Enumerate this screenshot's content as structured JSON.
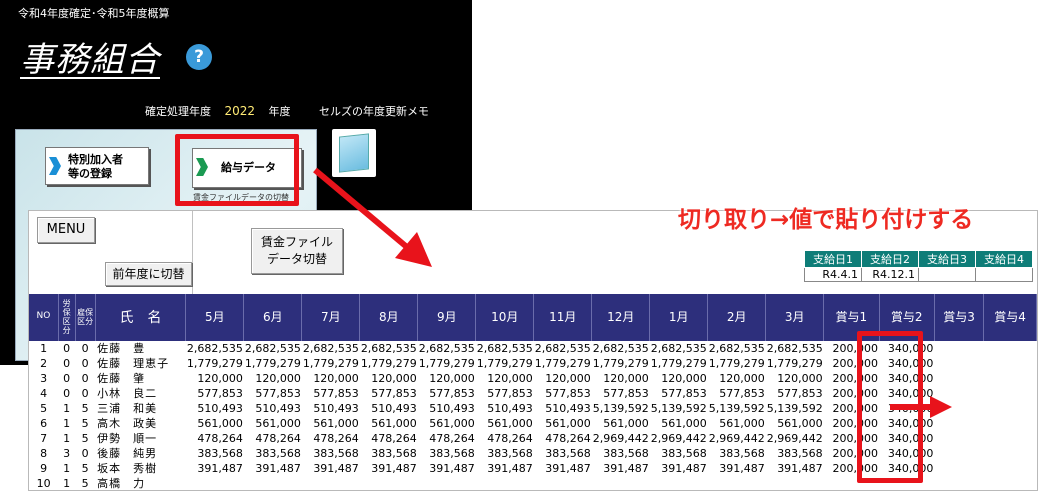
{
  "app": {
    "subtitle": "令和4年度確定･令和5年度概算",
    "title": "事務組合",
    "help_symbol": "?",
    "year_label": "確定処理年度",
    "year_value": "2022",
    "year_unit": "年度",
    "memo_label": "セルズの年度更新メモ",
    "btn_special_line1": "特別加入者",
    "btn_special_line2": "等の登録",
    "btn_salary": "給与データ",
    "salary_caption": "賃金ファイルデータの切替"
  },
  "annotation": {
    "headline": "切り取り→値で貼り付けする",
    "accent_color": "#e8131b"
  },
  "sheet": {
    "menu_label": "MENU",
    "prev_year_label": "前年度に切替",
    "wage_switch_line1": "賃金ファイル",
    "wage_switch_line2": "データ切替",
    "pay_days": {
      "headers": [
        "支給日1",
        "支給日2",
        "支給日3",
        "支給日4"
      ],
      "values": [
        "R4.4.1",
        "R4.12.1",
        "",
        ""
      ]
    },
    "columns": {
      "no": "NO",
      "rousai": "労保区分",
      "koyou": "雇保区分",
      "name": "氏　名",
      "months": [
        "5月",
        "6月",
        "7月",
        "8月",
        "9月",
        "10月",
        "11月",
        "12月",
        "1月",
        "2月",
        "3月"
      ],
      "bonus": [
        "賞与1",
        "賞与2",
        "賞与3",
        "賞与4"
      ]
    },
    "rows": [
      {
        "no": "1",
        "r": "0",
        "k": "0",
        "name": "佐藤　豊",
        "m": [
          "2,682,535",
          "2,682,535",
          "2,682,535",
          "2,682,535",
          "2,682,535",
          "2,682,535",
          "2,682,535",
          "2,682,535",
          "2,682,535",
          "2,682,535",
          "2,682,535"
        ],
        "b1": "200,000",
        "b2": "340,000"
      },
      {
        "no": "2",
        "r": "0",
        "k": "0",
        "name": "佐藤　理恵子",
        "m": [
          "1,779,279",
          "1,779,279",
          "1,779,279",
          "1,779,279",
          "1,779,279",
          "1,779,279",
          "1,779,279",
          "1,779,279",
          "1,779,279",
          "1,779,279",
          "1,779,279"
        ],
        "b1": "200,000",
        "b2": "340,000"
      },
      {
        "no": "3",
        "r": "0",
        "k": "0",
        "name": "佐藤　肇",
        "m": [
          "120,000",
          "120,000",
          "120,000",
          "120,000",
          "120,000",
          "120,000",
          "120,000",
          "120,000",
          "120,000",
          "120,000",
          "120,000"
        ],
        "b1": "200,000",
        "b2": "340,000"
      },
      {
        "no": "4",
        "r": "0",
        "k": "0",
        "name": "小林　良二",
        "m": [
          "577,853",
          "577,853",
          "577,853",
          "577,853",
          "577,853",
          "577,853",
          "577,853",
          "577,853",
          "577,853",
          "577,853",
          "577,853"
        ],
        "b1": "200,000",
        "b2": "340,000"
      },
      {
        "no": "5",
        "r": "1",
        "k": "5",
        "name": "三浦　和美",
        "m": [
          "510,493",
          "510,493",
          "510,493",
          "510,493",
          "510,493",
          "510,493",
          "510,493",
          "5,139,592",
          "5,139,592",
          "5,139,592",
          "5,139,592"
        ],
        "b1": "200,000",
        "b2": "340,000"
      },
      {
        "no": "6",
        "r": "1",
        "k": "5",
        "name": "高木　政美",
        "m": [
          "561,000",
          "561,000",
          "561,000",
          "561,000",
          "561,000",
          "561,000",
          "561,000",
          "561,000",
          "561,000",
          "561,000",
          "561,000"
        ],
        "b1": "200,000",
        "b2": "340,000"
      },
      {
        "no": "7",
        "r": "1",
        "k": "5",
        "name": "伊勢　順一",
        "m": [
          "478,264",
          "478,264",
          "478,264",
          "478,264",
          "478,264",
          "478,264",
          "478,264",
          "2,969,442",
          "2,969,442",
          "2,969,442",
          "2,969,442"
        ],
        "b1": "200,000",
        "b2": "340,000"
      },
      {
        "no": "8",
        "r": "3",
        "k": "0",
        "name": "後藤　純男",
        "m": [
          "383,568",
          "383,568",
          "383,568",
          "383,568",
          "383,568",
          "383,568",
          "383,568",
          "383,568",
          "383,568",
          "383,568",
          "383,568"
        ],
        "b1": "200,000",
        "b2": "340,000"
      },
      {
        "no": "9",
        "r": "1",
        "k": "5",
        "name": "坂本　秀樹",
        "m": [
          "391,487",
          "391,487",
          "391,487",
          "391,487",
          "391,487",
          "391,487",
          "391,487",
          "391,487",
          "391,487",
          "391,487",
          "391,487"
        ],
        "b1": "200,000",
        "b2": "340,000"
      },
      {
        "no": "10",
        "r": "1",
        "k": "5",
        "name": "高橋　力",
        "m": [
          "",
          "",
          "",
          "",
          "",
          "",
          "",
          "",
          "",
          "",
          ""
        ],
        "b1": "",
        "b2": ""
      }
    ]
  }
}
